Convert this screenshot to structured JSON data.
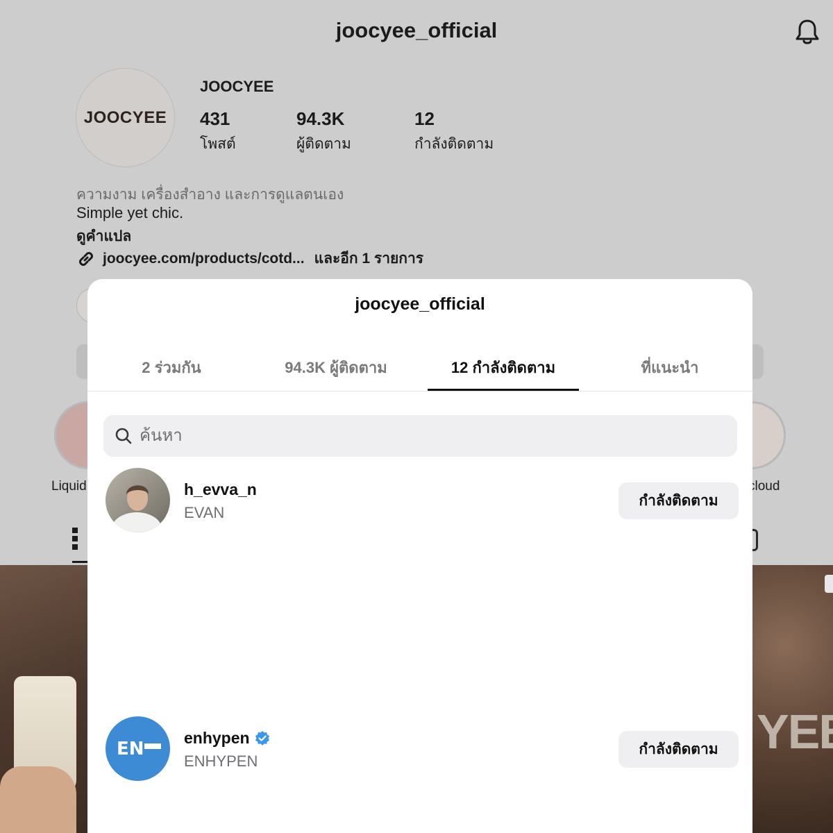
{
  "header": {
    "username": "joocyee_official"
  },
  "profile": {
    "avatar_text": "JOOCYEE",
    "display_name": "JOOCYEE",
    "stats": [
      {
        "value": "431",
        "label": "โพสต์"
      },
      {
        "value": "94.3K",
        "label": "ผู้ติดตาม"
      },
      {
        "value": "12",
        "label": "กำลังติดตาม"
      }
    ],
    "category": "ความงาม เครื่องสำอาง และการดูแลตนเอง",
    "bio": "Simple yet chic.",
    "translate": "ดูคำแปล",
    "link": "joocyee.com/products/cotd...",
    "link_more": "และอีก 1 รายการ",
    "highlights": {
      "left_label": "Liquid",
      "right_label": "cloud"
    },
    "post_watermark": "YEE"
  },
  "sheet": {
    "title": "joocyee_official",
    "tabs": [
      {
        "label": "2 ร่วมกัน",
        "active": false
      },
      {
        "label": "94.3K ผู้ติดตาม",
        "active": false
      },
      {
        "label": "12 กำลังติดตาม",
        "active": true
      },
      {
        "label": "ที่แนะนำ",
        "active": false
      }
    ],
    "search": {
      "placeholder": "ค้นหา",
      "value": ""
    },
    "following": [
      {
        "username": "h_evva_n",
        "name": "EVAN",
        "verified": false,
        "button": "กำลังติดตาม"
      },
      {
        "username": "enhypen",
        "name": "ENHYPEN",
        "verified": true,
        "button": "กำลังติดตาม",
        "avatar_text": "EN"
      }
    ]
  },
  "colors": {
    "verified_blue": "#3897f0",
    "enhypen_blue": "#3d8bd4"
  }
}
